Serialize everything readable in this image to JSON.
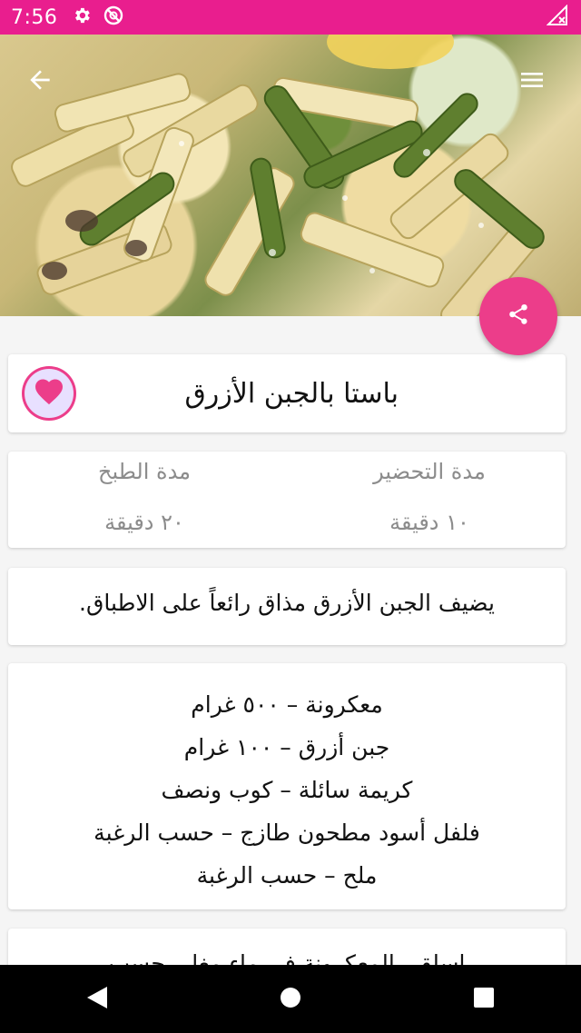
{
  "status_bar": {
    "time": "7:56",
    "icons": [
      "gear-icon",
      "no-sync-icon",
      "signal-icon"
    ],
    "background": "#e91e8e"
  },
  "hero": {
    "icons": {
      "back": "arrow-back-icon",
      "menu": "hamburger-menu-icon"
    }
  },
  "share_button": {
    "icon": "share-icon",
    "color": "#ec3d8a"
  },
  "recipe": {
    "title": "باستا بالجبن الأزرق",
    "favorite_icon": "heart-icon",
    "prep_label": "مدة التحضير",
    "prep_value": "١٠ دقيقة",
    "cook_label": "مدة الطبخ",
    "cook_value": "٢٠ دقيقة",
    "description": "يضيف الجبن الأزرق مذاق رائعاً على الاطباق.",
    "ingredients": [
      "معكرونة – ٥٠٠ غرام",
      "جبن أزرق – ١٠٠ غرام",
      "كريمة سائلة – كوب ونصف",
      "فلفل أسود مطحون طازج – حسب الرغبة",
      "ملح – حسب الرغبة"
    ],
    "steps_partial": "اسلقي المعكرونة في ماء مغلي حسب"
  },
  "nav_bar": {
    "icons": [
      "back-triangle-icon",
      "home-circle-icon",
      "recents-square-icon"
    ]
  }
}
